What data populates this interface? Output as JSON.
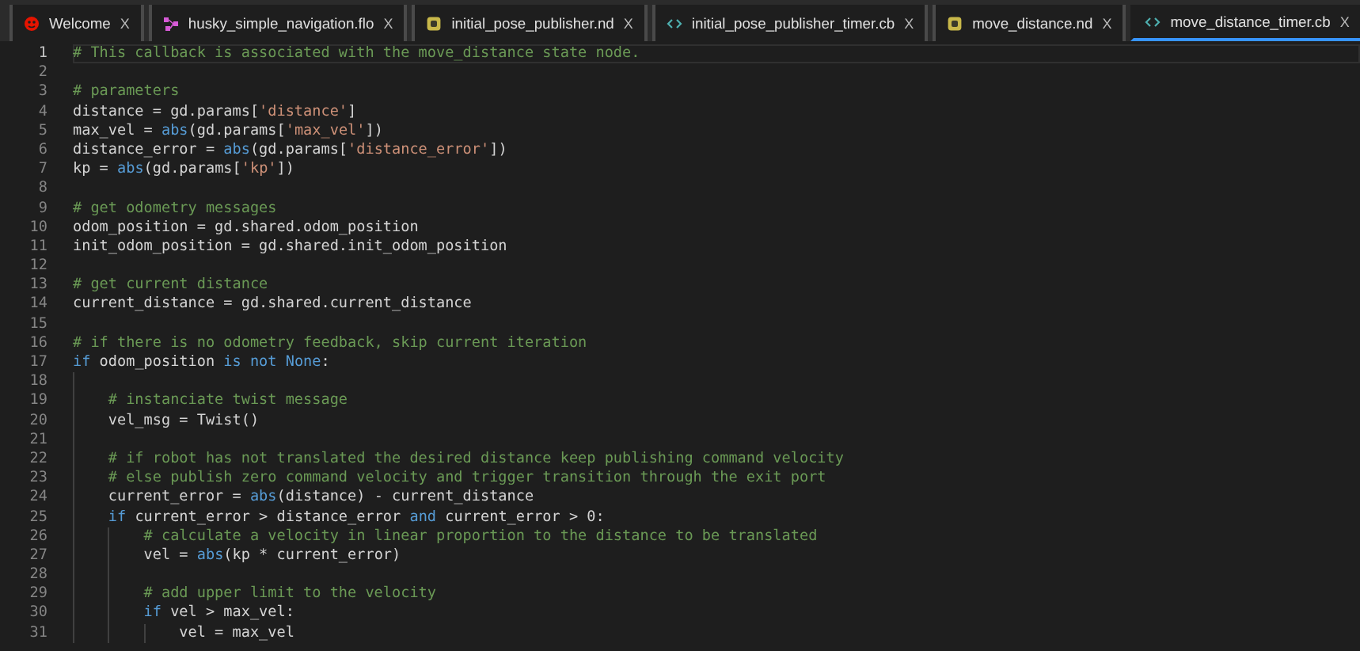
{
  "tabs": [
    {
      "label": "Welcome",
      "kind": "welcome",
      "close": "X",
      "selected": false
    },
    {
      "label": "husky_simple_navigation.flo",
      "kind": "flow",
      "close": "X",
      "selected": false
    },
    {
      "label": "initial_pose_publisher.nd",
      "kind": "node",
      "close": "X",
      "selected": false
    },
    {
      "label": "initial_pose_publisher_timer.cb",
      "kind": "code",
      "close": "X",
      "selected": false
    },
    {
      "label": "move_distance.nd",
      "kind": "node",
      "close": "X",
      "selected": false
    },
    {
      "label": "move_distance_timer.cb",
      "kind": "code",
      "close": "X",
      "selected": true
    }
  ],
  "editor": {
    "lines": [
      {
        "number": "1",
        "active": true,
        "tokens": [
          {
            "kind": "comment",
            "text": "# This callback is associated with the move_distance state node."
          }
        ]
      },
      {
        "number": "2",
        "active": false
      },
      {
        "number": "3",
        "active": false,
        "tokens": [
          {
            "kind": "comment",
            "text": "# parameters"
          }
        ]
      },
      {
        "number": "4",
        "active": false,
        "tokens": [
          {
            "kind": "plain",
            "text": "distance = gd.params["
          },
          {
            "kind": "string",
            "text": "'distance'"
          },
          {
            "kind": "plain",
            "text": "]"
          }
        ]
      },
      {
        "number": "5",
        "active": false,
        "tokens": [
          {
            "kind": "plain",
            "text": "max_vel = "
          },
          {
            "kind": "keyword",
            "text": "abs"
          },
          {
            "kind": "plain",
            "text": "(gd.params["
          },
          {
            "kind": "string",
            "text": "'max_vel'"
          },
          {
            "kind": "plain",
            "text": "])"
          }
        ]
      },
      {
        "number": "6",
        "active": false,
        "tokens": [
          {
            "kind": "plain",
            "text": "distance_error = "
          },
          {
            "kind": "keyword",
            "text": "abs"
          },
          {
            "kind": "plain",
            "text": "(gd.params["
          },
          {
            "kind": "string",
            "text": "'distance_error'"
          },
          {
            "kind": "plain",
            "text": "])"
          }
        ]
      },
      {
        "number": "7",
        "active": false,
        "tokens": [
          {
            "kind": "plain",
            "text": "kp = "
          },
          {
            "kind": "keyword",
            "text": "abs"
          },
          {
            "kind": "plain",
            "text": "(gd.params["
          },
          {
            "kind": "string",
            "text": "'kp'"
          },
          {
            "kind": "plain",
            "text": "])"
          }
        ]
      },
      {
        "number": "8",
        "active": false
      },
      {
        "number": "9",
        "active": false,
        "tokens": [
          {
            "kind": "comment",
            "text": "# get odometry messages"
          }
        ]
      },
      {
        "number": "10",
        "active": false,
        "tokens": [
          {
            "kind": "plain",
            "text": "odom_position = gd.shared.odom_position"
          }
        ]
      },
      {
        "number": "11",
        "active": false,
        "tokens": [
          {
            "kind": "plain",
            "text": "init_odom_position = gd.shared.init_odom_position"
          }
        ]
      },
      {
        "number": "12",
        "active": false
      },
      {
        "number": "13",
        "active": false,
        "tokens": [
          {
            "kind": "comment",
            "text": "# get current distance"
          }
        ]
      },
      {
        "number": "14",
        "active": false,
        "tokens": [
          {
            "kind": "plain",
            "text": "current_distance = gd.shared.current_distance"
          }
        ]
      },
      {
        "number": "15",
        "active": false
      },
      {
        "number": "16",
        "active": false,
        "tokens": [
          {
            "kind": "comment",
            "text": "# if there is no odometry feedback, skip current iteration"
          }
        ]
      },
      {
        "number": "17",
        "active": false,
        "tokens": [
          {
            "kind": "keyword",
            "text": "if"
          },
          {
            "kind": "plain",
            "text": " odom_position "
          },
          {
            "kind": "keyword",
            "text": "is not None"
          },
          {
            "kind": "plain",
            "text": ":"
          }
        ]
      },
      {
        "number": "18",
        "active": false
      },
      {
        "number": "19",
        "active": false,
        "tokens": [
          {
            "kind": "comment",
            "text": "    # instanciate twist message"
          }
        ]
      },
      {
        "number": "20",
        "active": false,
        "tokens": [
          {
            "kind": "plain",
            "text": "    vel_msg = Twist()"
          }
        ]
      },
      {
        "number": "21",
        "active": false
      },
      {
        "number": "22",
        "active": false,
        "tokens": [
          {
            "kind": "comment",
            "text": "    # if robot has not translated the desired distance keep publishing command velocity"
          }
        ]
      },
      {
        "number": "23",
        "active": false,
        "tokens": [
          {
            "kind": "comment",
            "text": "    # else publish zero command velocity and trigger transition through the exit port"
          }
        ]
      },
      {
        "number": "24",
        "active": false,
        "tokens": [
          {
            "kind": "plain",
            "text": "    current_error = "
          },
          {
            "kind": "keyword",
            "text": "abs"
          },
          {
            "kind": "plain",
            "text": "(distance) - current_distance"
          }
        ]
      },
      {
        "number": "25",
        "active": false,
        "tokens": [
          {
            "kind": "keyword",
            "text": "    if"
          },
          {
            "kind": "plain",
            "text": " current_error > distance_error "
          },
          {
            "kind": "keyword",
            "text": "and"
          },
          {
            "kind": "plain",
            "text": " current_error > 0:"
          }
        ]
      },
      {
        "number": "26",
        "active": false,
        "tokens": [
          {
            "kind": "comment",
            "text": "        # calculate a velocity in linear proportion to the distance to be translated"
          }
        ]
      },
      {
        "number": "27",
        "active": false,
        "tokens": [
          {
            "kind": "plain",
            "text": "        vel = "
          },
          {
            "kind": "keyword",
            "text": "abs"
          },
          {
            "kind": "plain",
            "text": "(kp * current_error)"
          }
        ]
      },
      {
        "number": "28",
        "active": false
      },
      {
        "number": "29",
        "active": false,
        "tokens": [
          {
            "kind": "comment",
            "text": "        # add upper limit to the velocity"
          }
        ]
      },
      {
        "number": "30",
        "active": false,
        "tokens": [
          {
            "kind": "keyword",
            "text": "        if"
          },
          {
            "kind": "plain",
            "text": " vel > max_vel:"
          }
        ]
      },
      {
        "number": "31",
        "active": false,
        "tokens": [
          {
            "kind": "plain",
            "text": "            vel = max_vel"
          }
        ]
      }
    ]
  }
}
